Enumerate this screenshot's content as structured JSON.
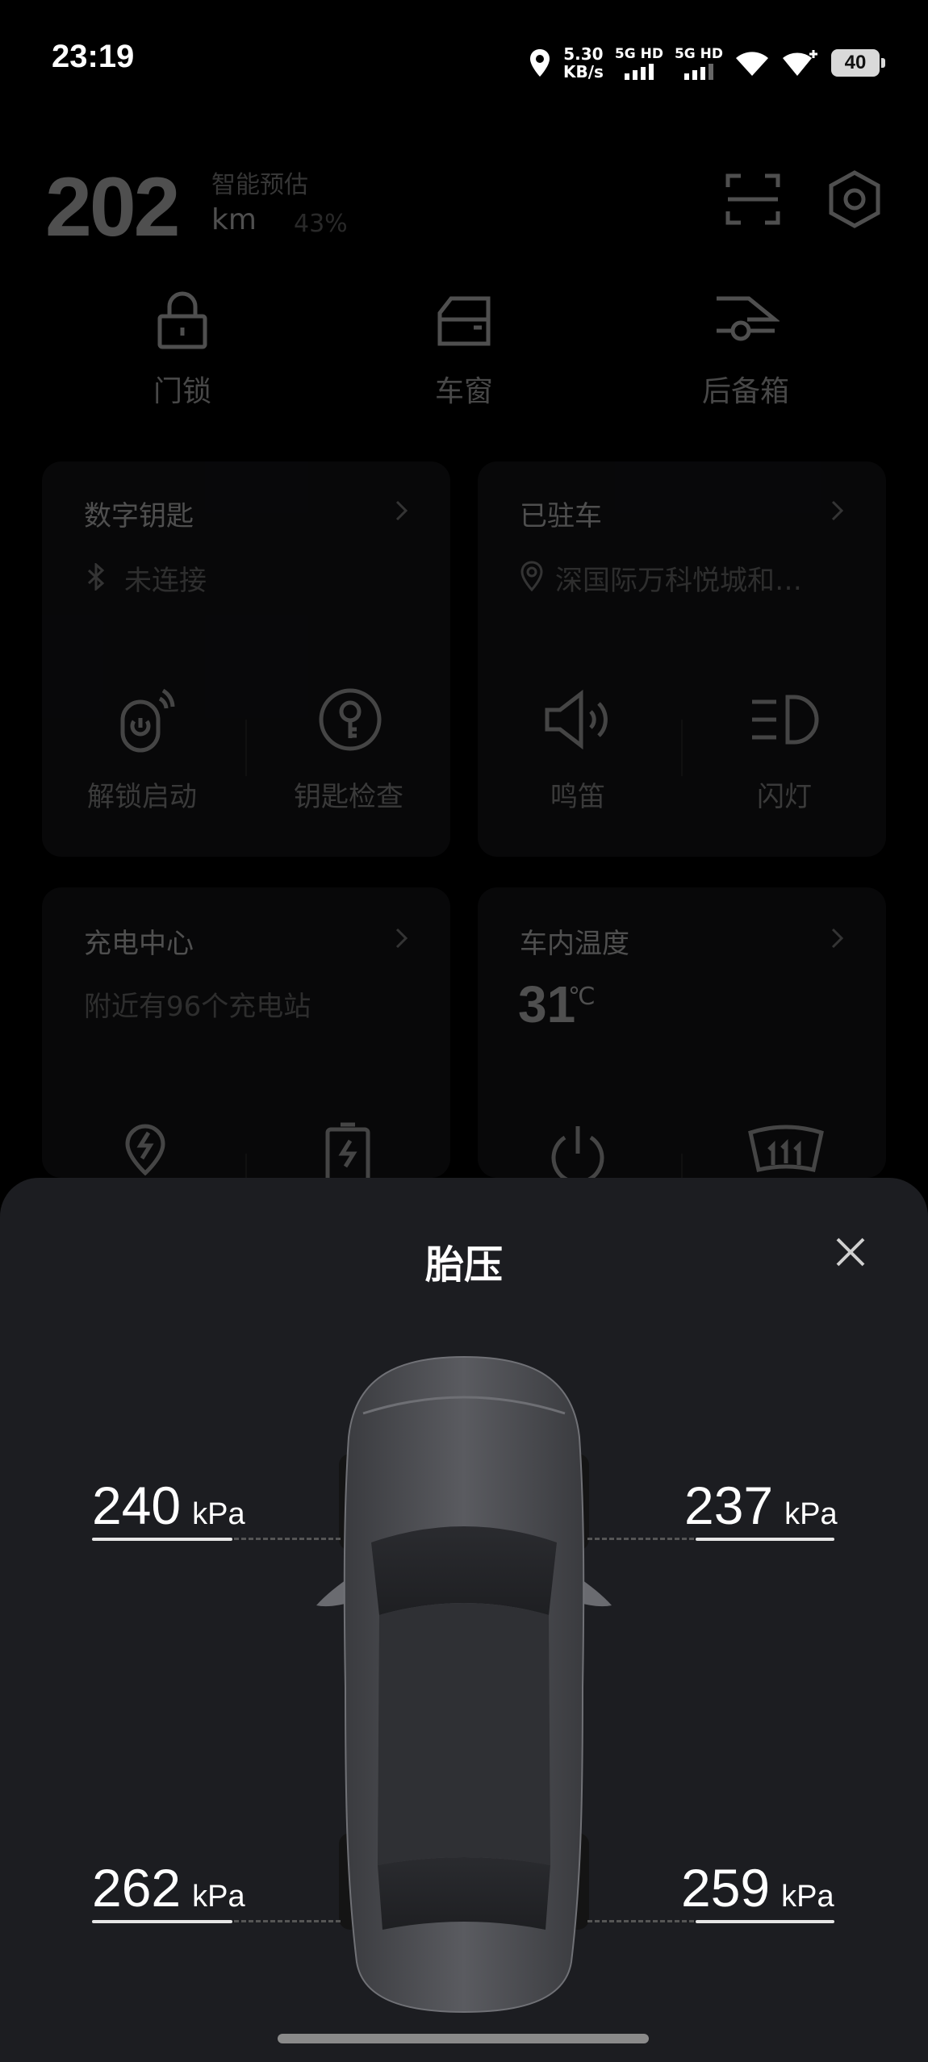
{
  "status_bar": {
    "time": "23:19",
    "net_speed_value": "5.30",
    "net_speed_unit": "KB/s",
    "sim1_label": "5G HD",
    "sim2_label": "5G HD",
    "battery": "40",
    "icons": [
      "location-icon",
      "wifi-icon",
      "wifi-plus-icon"
    ]
  },
  "range": {
    "value": "202",
    "label": "智能预估",
    "unit": "km",
    "percent": "43%"
  },
  "header_icons": [
    "scan-icon",
    "settings-hexagon-icon"
  ],
  "quick_controls": [
    {
      "label": "门锁",
      "icon": "lock-icon"
    },
    {
      "label": "车窗",
      "icon": "car-window-icon"
    },
    {
      "label": "后备箱",
      "icon": "trunk-icon"
    }
  ],
  "cards": {
    "digital_key": {
      "title": "数字钥匙",
      "status": "未连接",
      "actions": [
        {
          "label": "解锁启动",
          "icon": "unlock-start-icon"
        },
        {
          "label": "钥匙检查",
          "icon": "key-check-icon"
        }
      ]
    },
    "parked": {
      "title": "已驻车",
      "location": "深国际万科悦城和…",
      "actions": [
        {
          "label": "鸣笛",
          "icon": "horn-icon"
        },
        {
          "label": "闪灯",
          "icon": "headlight-icon"
        }
      ]
    },
    "charging": {
      "title": "充电中心",
      "subtitle": "附近有96个充电站"
    },
    "cabin_temp": {
      "title": "车内温度",
      "value": "31",
      "unit": "℃"
    }
  },
  "tire_sheet": {
    "title": "胎压",
    "unit": "kPa",
    "front_left": "240",
    "front_right": "237",
    "rear_left": "262",
    "rear_right": "259"
  }
}
